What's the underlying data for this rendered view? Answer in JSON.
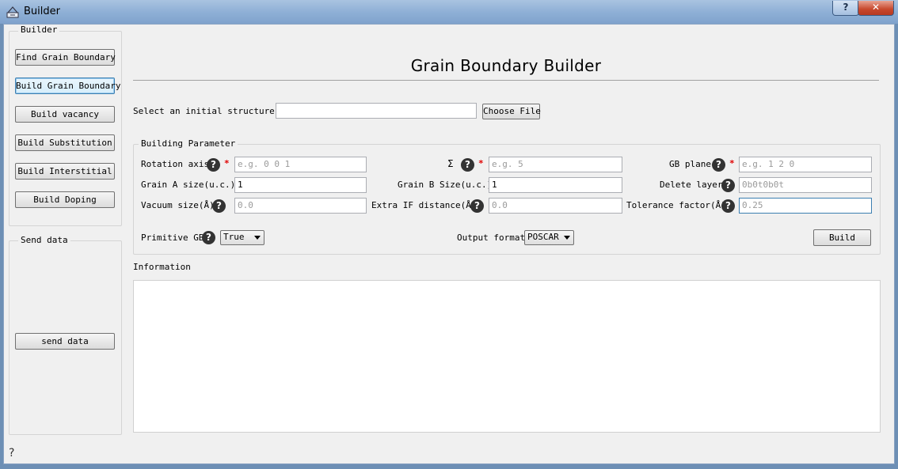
{
  "window": {
    "title": "Builder",
    "help_glyph": "?",
    "close_glyph": "✕",
    "app_icon": "builder-icon"
  },
  "sidebar": {
    "builder_group_title": "Builder",
    "buttons": [
      "Find Grain Boundary",
      "Build Grain Boundary",
      "Build vacancy",
      "Build Substitution",
      "Build Interstitial",
      "Build Doping"
    ],
    "send_group_title": "Send data",
    "send_button": "send data"
  },
  "main": {
    "title": "Grain Boundary Builder",
    "select_label": "Select an initial structure",
    "required_mark": "*",
    "structure_path": "",
    "choose_file": "Choose File",
    "params_title": "Building Parameter",
    "rotation_axis": {
      "label": "Rotation axis",
      "placeholder": "e.g. 0 0 1"
    },
    "sigma": {
      "label": "Σ",
      "placeholder": "e.g. 5"
    },
    "gb_plane": {
      "label": "GB plane",
      "placeholder": "e.g. 1 2 0"
    },
    "grain_a": {
      "label": "Grain A size(u.c.)",
      "value": "1"
    },
    "grain_b": {
      "label": "Grain B Size(u.c.)",
      "value": "1"
    },
    "delete_layer": {
      "label": "Delete layer",
      "placeholder": "0b0t0b0t"
    },
    "vacuum": {
      "label": "Vacuum size(Å)",
      "placeholder": "0.0"
    },
    "extra_if": {
      "label": "Extra IF distance(Å)",
      "placeholder": "0.0"
    },
    "tolerance": {
      "label": "Tolerance factor(Å)",
      "placeholder": "0.25"
    },
    "primitive": {
      "label": "Primitive GB",
      "value": "True"
    },
    "output_format": {
      "label": "Output format",
      "value": "POSCAR"
    },
    "build": "Build",
    "info_label": "Information",
    "help_icon": "?"
  },
  "status_help_icon": "?"
}
